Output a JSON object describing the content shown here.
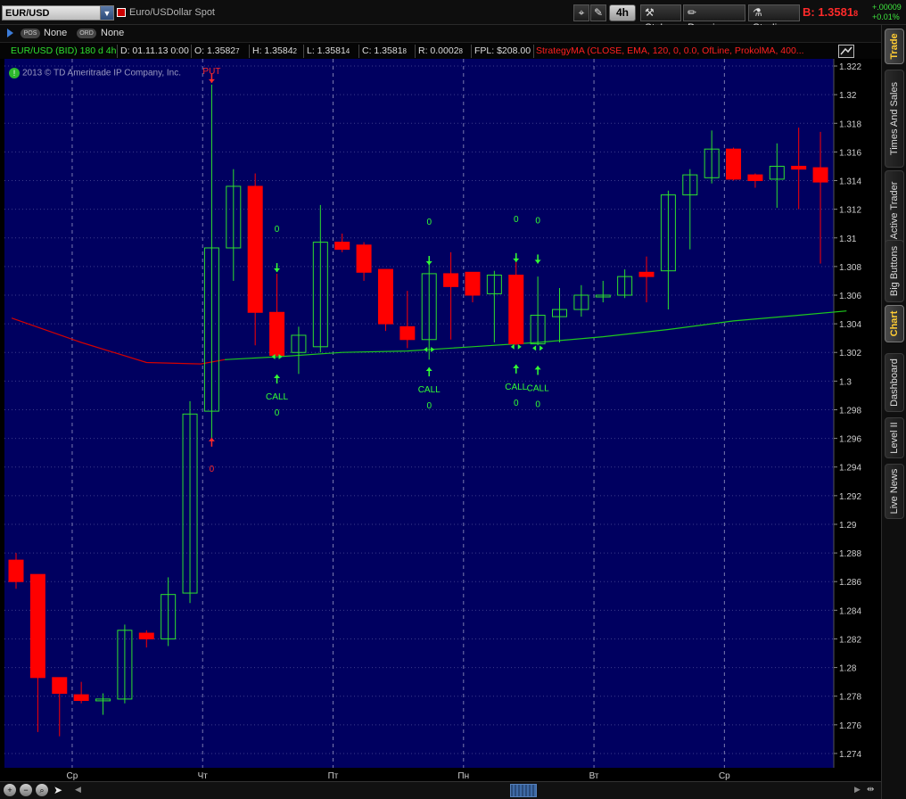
{
  "topbar": {
    "symbol": "EUR/USD",
    "description": "Euro/USDollar Spot",
    "timeframe": "4h",
    "style_label": "Style",
    "drawings_label": "Drawings",
    "studies_label": "Studies",
    "bid": "B: 1.3581",
    "bid_sub": "8",
    "change_abs": "+.00009",
    "change_pct": "+0.01%"
  },
  "posbar": {
    "pos_label": "POS",
    "pos_value": "None",
    "ord_label": "ORD",
    "ord_value": "None"
  },
  "info": {
    "symbol": "EUR/USD (BID) 180 d 4h",
    "date": "D: 01.11.13 0:00",
    "open": "O: 1.3582",
    "open_sub": "7",
    "high": "H: 1.3584",
    "high_sub": "2",
    "low": "L: 1.3581",
    "low_sub": "4",
    "close": "C: 1.3581",
    "close_sub": "8",
    "range": "R: 0.0002",
    "range_sub": "8",
    "fpl": "FPL: $208.00",
    "study": "StrategyMA (CLOSE, EMA, 120, 0, 0.0, OfLine, ProkolMA, 400..."
  },
  "chart": {
    "copyright": "2013 © TD Ameritrade IP Company, Inc."
  },
  "colors": {
    "bg": "#000060",
    "up": "#2ee02e",
    "down": "#ff0000",
    "ma_red": "#d40000",
    "ma_green": "#1ec81e",
    "signal_red": "#ff2a2a",
    "signal_green": "#33ff33"
  },
  "side_tabs": [
    "Trade",
    "Times And Sales",
    "Active Trader",
    "Big Buttons",
    "Chart",
    "Dashboard",
    "Level II",
    "Live News"
  ],
  "chart_data": {
    "type": "candlestick",
    "y_axis": {
      "min": 1.273,
      "max": 1.3225,
      "ticks": [
        1.274,
        1.276,
        1.278,
        1.28,
        1.282,
        1.284,
        1.286,
        1.288,
        1.29,
        1.292,
        1.294,
        1.296,
        1.298,
        1.3,
        1.302,
        1.304,
        1.306,
        1.308,
        1.31,
        1.312,
        1.314,
        1.316,
        1.318,
        1.32,
        1.322
      ],
      "tick_labels": [
        "1.274",
        "1.276",
        "1.278",
        "1.28",
        "1.282",
        "1.284",
        "1.286",
        "1.288",
        "1.29",
        "1.292",
        "1.294",
        "1.296",
        "1.298",
        "1.3",
        "1.302",
        "1.304",
        "1.306",
        "1.308",
        "1.31",
        "1.312",
        "1.314",
        "1.316",
        "1.318",
        "1.32",
        "1.322"
      ]
    },
    "x_labels": [
      {
        "label": "Ср",
        "bar": 3
      },
      {
        "label": "Чт",
        "bar": 9
      },
      {
        "label": "Пт",
        "bar": 15
      },
      {
        "label": "Пн",
        "bar": 21
      },
      {
        "label": "Вт",
        "bar": 27
      },
      {
        "label": "Ср",
        "bar": 33
      }
    ],
    "separator_bars": [
      3,
      9,
      15,
      21,
      27,
      33
    ],
    "grid": true,
    "candles": [
      {
        "o": 1.2875,
        "h": 1.288,
        "l": 1.2855,
        "c": 1.286
      },
      {
        "o": 1.2865,
        "h": 1.2865,
        "l": 1.2755,
        "c": 1.2793
      },
      {
        "o": 1.2793,
        "h": 1.2793,
        "l": 1.2752,
        "c": 1.2782
      },
      {
        "o": 1.2781,
        "h": 1.279,
        "l": 1.2775,
        "c": 1.2777
      },
      {
        "o": 1.2777,
        "h": 1.2782,
        "l": 1.2767,
        "c": 1.2778
      },
      {
        "o": 1.2778,
        "h": 1.283,
        "l": 1.2775,
        "c": 1.2826
      },
      {
        "o": 1.2824,
        "h": 1.2826,
        "l": 1.2814,
        "c": 1.282
      },
      {
        "o": 1.282,
        "h": 1.2863,
        "l": 1.2815,
        "c": 1.2851
      },
      {
        "o": 1.2852,
        "h": 1.2986,
        "l": 1.2845,
        "c": 1.2977
      },
      {
        "o": 1.2979,
        "h": 1.3207,
        "l": 1.2958,
        "c": 1.3093
      },
      {
        "o": 1.3093,
        "h": 1.3148,
        "l": 1.307,
        "c": 1.3136
      },
      {
        "o": 1.3136,
        "h": 1.3145,
        "l": 1.3025,
        "c": 1.3048
      },
      {
        "o": 1.3048,
        "h": 1.3075,
        "l": 1.3017,
        "c": 1.3018
      },
      {
        "o": 1.302,
        "h": 1.3038,
        "l": 1.3005,
        "c": 1.3032
      },
      {
        "o": 1.3024,
        "h": 1.3123,
        "l": 1.302,
        "c": 1.3097
      },
      {
        "o": 1.3097,
        "h": 1.3103,
        "l": 1.309,
        "c": 1.3092
      },
      {
        "o": 1.3095,
        "h": 1.3097,
        "l": 1.307,
        "c": 1.3076
      },
      {
        "o": 1.3078,
        "h": 1.3078,
        "l": 1.3035,
        "c": 1.304
      },
      {
        "o": 1.3038,
        "h": 1.3063,
        "l": 1.3023,
        "c": 1.3029
      },
      {
        "o": 1.3029,
        "h": 1.3085,
        "l": 1.3015,
        "c": 1.3075
      },
      {
        "o": 1.3075,
        "h": 1.309,
        "l": 1.3029,
        "c": 1.3066
      },
      {
        "o": 1.3076,
        "h": 1.3076,
        "l": 1.3055,
        "c": 1.306
      },
      {
        "o": 1.3061,
        "h": 1.3077,
        "l": 1.3027,
        "c": 1.3074
      },
      {
        "o": 1.3074,
        "h": 1.3083,
        "l": 1.3025,
        "c": 1.3026
      },
      {
        "o": 1.3026,
        "h": 1.3073,
        "l": 1.3025,
        "c": 1.3046
      },
      {
        "o": 1.3045,
        "h": 1.3065,
        "l": 1.3027,
        "c": 1.305
      },
      {
        "o": 1.305,
        "h": 1.3067,
        "l": 1.3045,
        "c": 1.306
      },
      {
        "o": 1.306,
        "h": 1.307,
        "l": 1.3055,
        "c": 1.306
      },
      {
        "o": 1.306,
        "h": 1.3078,
        "l": 1.3058,
        "c": 1.3073
      },
      {
        "o": 1.3076,
        "h": 1.3087,
        "l": 1.3055,
        "c": 1.3073
      },
      {
        "o": 1.3077,
        "h": 1.3133,
        "l": 1.305,
        "c": 1.313
      },
      {
        "o": 1.313,
        "h": 1.3148,
        "l": 1.3092,
        "c": 1.3144
      },
      {
        "o": 1.3142,
        "h": 1.3175,
        "l": 1.3138,
        "c": 1.3162
      },
      {
        "o": 1.3162,
        "h": 1.3163,
        "l": 1.314,
        "c": 1.3141
      },
      {
        "o": 1.3144,
        "h": 1.3145,
        "l": 1.3135,
        "c": 1.314
      },
      {
        "o": 1.3141,
        "h": 1.3166,
        "l": 1.3121,
        "c": 1.315
      },
      {
        "o": 1.315,
        "h": 1.3177,
        "l": 1.312,
        "c": 1.3148
      },
      {
        "o": 1.3149,
        "h": 1.3174,
        "l": 1.3082,
        "c": 1.3139
      }
    ],
    "ma": [
      {
        "bar": -0.2,
        "v": 1.3044
      },
      {
        "bar": 3,
        "v": 1.3027
      },
      {
        "bar": 6,
        "v": 1.3013
      },
      {
        "bar": 8.5,
        "v": 1.3012
      },
      {
        "bar": 9.6,
        "v": 1.3015
      },
      {
        "bar": 12,
        "v": 1.3017
      },
      {
        "bar": 15,
        "v": 1.302
      },
      {
        "bar": 18,
        "v": 1.3021
      },
      {
        "bar": 21,
        "v": 1.3024
      },
      {
        "bar": 24,
        "v": 1.3027
      },
      {
        "bar": 27,
        "v": 1.3031
      },
      {
        "bar": 30,
        "v": 1.3036
      },
      {
        "bar": 33,
        "v": 1.3042
      },
      {
        "bar": 36,
        "v": 1.3046
      },
      {
        "bar": 38.2,
        "v": 1.3049
      }
    ],
    "ma_cross_bar": 9.6,
    "signals": [
      {
        "bar": 9,
        "type": "PUT",
        "label": "PUT",
        "price": 1.3207,
        "qty_below": "0",
        "qty_price": 1.2953
      },
      {
        "bar": 12,
        "type": "CALL",
        "label": "CALL",
        "price": 1.3017,
        "qty_above": "0",
        "qty_below": "0"
      },
      {
        "bar": 19,
        "type": "CALL",
        "label": "CALL",
        "price": 1.3022,
        "qty_above": "0",
        "qty_below": "0"
      },
      {
        "bar": 23,
        "type": "CALL",
        "label": "CALL",
        "price": 1.3024,
        "qty_above": "0",
        "qty_below": "0"
      },
      {
        "bar": 24,
        "type": "CALL",
        "label": "CALL",
        "price": 1.3023,
        "qty_above": "0",
        "qty_below": "0"
      }
    ]
  }
}
